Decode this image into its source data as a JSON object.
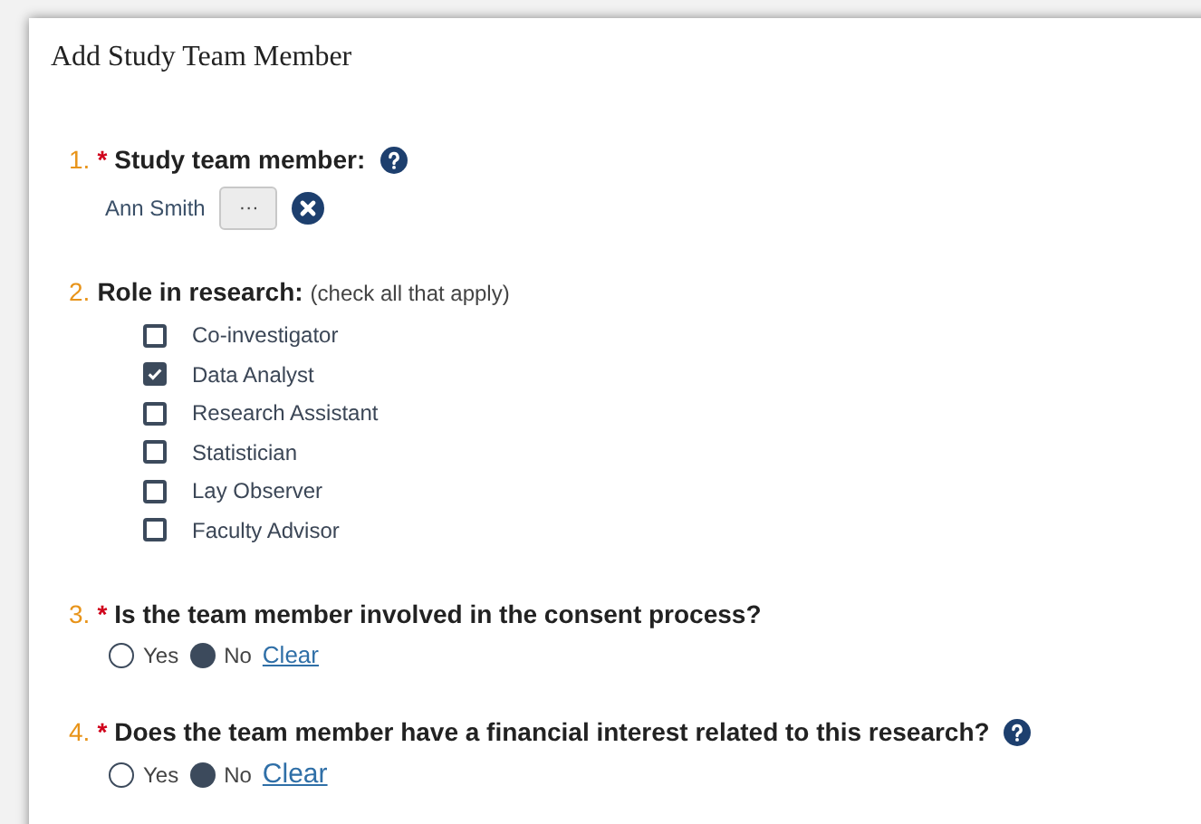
{
  "title": "Add Study Team Member",
  "questions": [
    {
      "kind": "person",
      "number": "1.",
      "asterisk": "*",
      "label": "Study team member:",
      "help": true,
      "value": "Ann Smith",
      "browse": "···"
    },
    {
      "kind": "checkboxes",
      "number": "2.",
      "label": "Role in research:",
      "hint": "(check all that apply)",
      "help": false,
      "options": [
        {
          "label": "Co-investigator",
          "checked": false
        },
        {
          "label": "Data Analyst",
          "checked": true
        },
        {
          "label": "Research Assistant",
          "checked": false
        },
        {
          "label": "Statistician",
          "checked": false
        },
        {
          "label": "Lay Observer",
          "checked": false
        },
        {
          "label": "Faculty Advisor",
          "checked": false
        }
      ]
    },
    {
      "kind": "radio",
      "number": "3.",
      "asterisk": "*",
      "label": "Is the team member involved in the consent process?",
      "help": false,
      "options": [
        {
          "label": "Yes",
          "selected": false
        },
        {
          "label": "No",
          "selected": true
        }
      ],
      "clear": "Clear"
    },
    {
      "kind": "radio",
      "number": "4.",
      "asterisk": "*",
      "label": "Does the team member have a financial interest related to this research?",
      "help": true,
      "options": [
        {
          "label": "Yes",
          "selected": false
        },
        {
          "label": "No",
          "selected": true
        }
      ],
      "clear": "Clear"
    }
  ]
}
